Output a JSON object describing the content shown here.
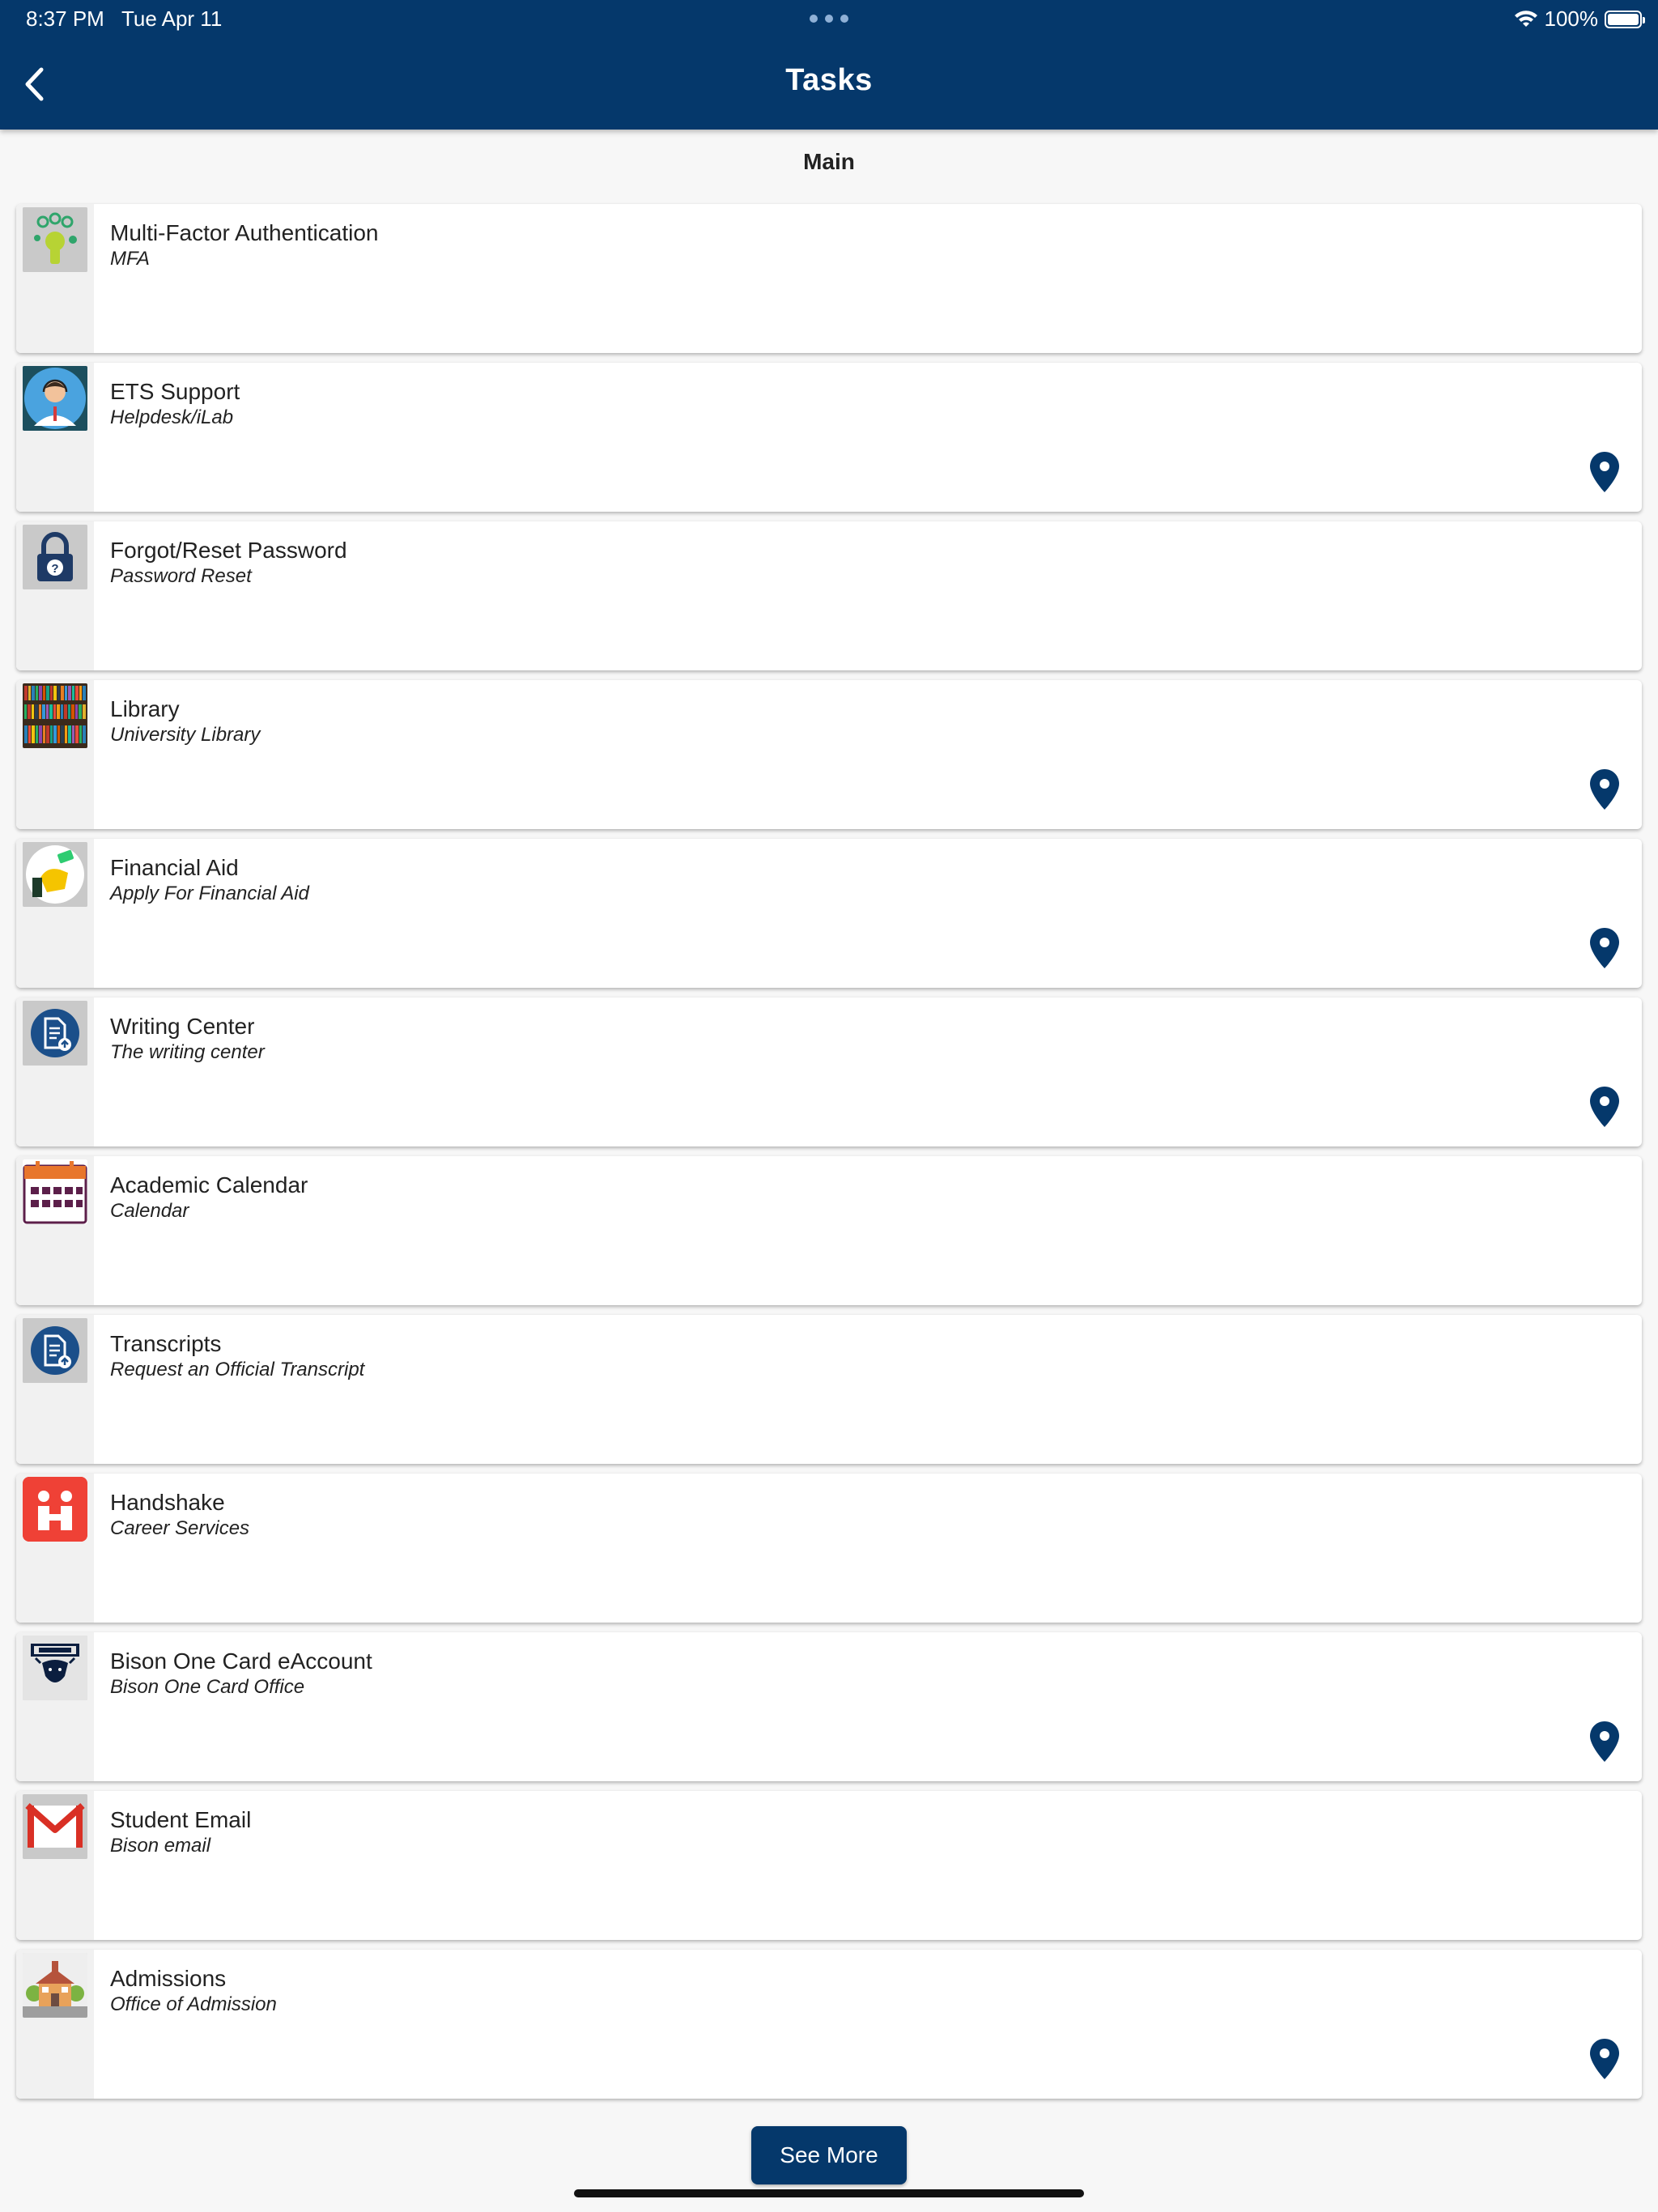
{
  "status_bar": {
    "time": "8:37 PM",
    "date": "Tue Apr 11",
    "battery": "100%"
  },
  "header": {
    "title": "Tasks"
  },
  "section": {
    "heading": "Main"
  },
  "tasks": [
    {
      "title": "Multi-Factor Authentication",
      "subtitle": "MFA",
      "icon": "mfa-icon",
      "has_location": false
    },
    {
      "title": "ETS Support",
      "subtitle": "Helpdesk/iLab",
      "icon": "support-agent-icon",
      "has_location": true
    },
    {
      "title": "Forgot/Reset Password",
      "subtitle": "Password Reset",
      "icon": "lock-icon",
      "has_location": false
    },
    {
      "title": "Library",
      "subtitle": "University Library",
      "icon": "bookshelf-icon",
      "has_location": true
    },
    {
      "title": "Financial Aid",
      "subtitle": "Apply For Financial Aid",
      "icon": "money-hand-icon",
      "has_location": true
    },
    {
      "title": "Writing Center",
      "subtitle": "The writing center",
      "icon": "document-upload-icon",
      "has_location": true
    },
    {
      "title": "Academic Calendar",
      "subtitle": "Calendar",
      "icon": "calendar-icon",
      "has_location": false
    },
    {
      "title": "Transcripts",
      "subtitle": "Request an Official Transcript",
      "icon": "document-upload-icon",
      "has_location": false
    },
    {
      "title": "Handshake",
      "subtitle": "Career Services",
      "icon": "handshake-logo-icon",
      "has_location": false
    },
    {
      "title": "Bison One Card eAccount",
      "subtitle": "Bison One Card Office",
      "icon": "bison-logo-icon",
      "has_location": true
    },
    {
      "title": "Student Email",
      "subtitle": "Bison email",
      "icon": "gmail-icon",
      "has_location": false
    },
    {
      "title": "Admissions",
      "subtitle": "Office of Admission",
      "icon": "school-building-icon",
      "has_location": true
    }
  ],
  "see_more": {
    "label": "See More"
  },
  "colors": {
    "header": "#05386b",
    "accent": "#05386b",
    "background": "#f7f7f7"
  }
}
